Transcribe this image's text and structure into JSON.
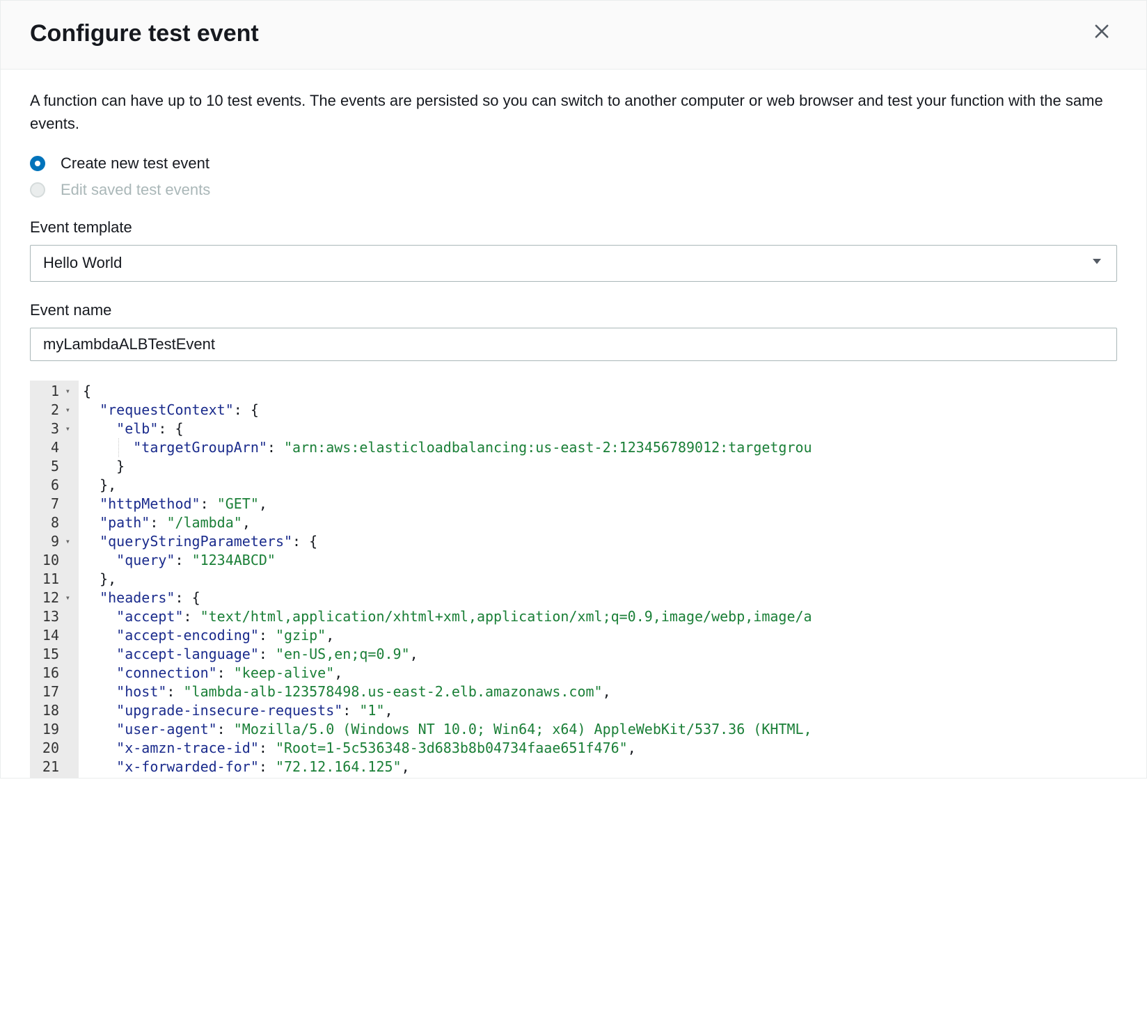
{
  "modal": {
    "title": "Configure test event",
    "description": "A function can have up to 10 test events. The events are persisted so you can switch to another computer or web browser and test your function with the same events."
  },
  "radios": {
    "create_label": "Create new test event",
    "edit_label": "Edit saved test events"
  },
  "template": {
    "label": "Event template",
    "selected": "Hello World"
  },
  "event_name": {
    "label": "Event name",
    "value": "myLambdaALBTestEvent"
  },
  "code": {
    "lines": [
      {
        "n": 1,
        "fold": true,
        "indent": 0,
        "tokens": [
          [
            "brace",
            "{"
          ]
        ]
      },
      {
        "n": 2,
        "fold": true,
        "indent": 1,
        "tokens": [
          [
            "key",
            "\"requestContext\""
          ],
          [
            "punct",
            ": "
          ],
          [
            "brace",
            "{"
          ]
        ]
      },
      {
        "n": 3,
        "fold": true,
        "indent": 2,
        "tokens": [
          [
            "key",
            "\"elb\""
          ],
          [
            "punct",
            ": "
          ],
          [
            "brace",
            "{"
          ]
        ]
      },
      {
        "n": 4,
        "fold": false,
        "indent": 3,
        "tokens": [
          [
            "key",
            "\"targetGroupArn\""
          ],
          [
            "punct",
            ": "
          ],
          [
            "str",
            "\"arn:aws:elasticloadbalancing:us-east-2:123456789012:targetgrou"
          ]
        ]
      },
      {
        "n": 5,
        "fold": false,
        "indent": 2,
        "tokens": [
          [
            "brace",
            "}"
          ]
        ]
      },
      {
        "n": 6,
        "fold": false,
        "indent": 1,
        "tokens": [
          [
            "brace",
            "}"
          ],
          [
            "punct",
            ","
          ]
        ]
      },
      {
        "n": 7,
        "fold": false,
        "indent": 1,
        "tokens": [
          [
            "key",
            "\"httpMethod\""
          ],
          [
            "punct",
            ": "
          ],
          [
            "str",
            "\"GET\""
          ],
          [
            "punct",
            ","
          ]
        ]
      },
      {
        "n": 8,
        "fold": false,
        "indent": 1,
        "tokens": [
          [
            "key",
            "\"path\""
          ],
          [
            "punct",
            ": "
          ],
          [
            "str",
            "\"/lambda\""
          ],
          [
            "punct",
            ","
          ]
        ]
      },
      {
        "n": 9,
        "fold": true,
        "indent": 1,
        "tokens": [
          [
            "key",
            "\"queryStringParameters\""
          ],
          [
            "punct",
            ": "
          ],
          [
            "brace",
            "{"
          ]
        ]
      },
      {
        "n": 10,
        "fold": false,
        "indent": 2,
        "tokens": [
          [
            "key",
            "\"query\""
          ],
          [
            "punct",
            ": "
          ],
          [
            "str",
            "\"1234ABCD\""
          ]
        ]
      },
      {
        "n": 11,
        "fold": false,
        "indent": 1,
        "tokens": [
          [
            "brace",
            "}"
          ],
          [
            "punct",
            ","
          ]
        ]
      },
      {
        "n": 12,
        "fold": true,
        "indent": 1,
        "tokens": [
          [
            "key",
            "\"headers\""
          ],
          [
            "punct",
            ": "
          ],
          [
            "brace",
            "{"
          ]
        ]
      },
      {
        "n": 13,
        "fold": false,
        "indent": 2,
        "tokens": [
          [
            "key",
            "\"accept\""
          ],
          [
            "punct",
            ": "
          ],
          [
            "str",
            "\"text/html,application/xhtml+xml,application/xml;q=0.9,image/webp,image/a"
          ]
        ]
      },
      {
        "n": 14,
        "fold": false,
        "indent": 2,
        "tokens": [
          [
            "key",
            "\"accept-encoding\""
          ],
          [
            "punct",
            ": "
          ],
          [
            "str",
            "\"gzip\""
          ],
          [
            "punct",
            ","
          ]
        ]
      },
      {
        "n": 15,
        "fold": false,
        "indent": 2,
        "tokens": [
          [
            "key",
            "\"accept-language\""
          ],
          [
            "punct",
            ": "
          ],
          [
            "str",
            "\"en-US,en;q=0.9\""
          ],
          [
            "punct",
            ","
          ]
        ]
      },
      {
        "n": 16,
        "fold": false,
        "indent": 2,
        "tokens": [
          [
            "key",
            "\"connection\""
          ],
          [
            "punct",
            ": "
          ],
          [
            "str",
            "\"keep-alive\""
          ],
          [
            "punct",
            ","
          ]
        ]
      },
      {
        "n": 17,
        "fold": false,
        "indent": 2,
        "tokens": [
          [
            "key",
            "\"host\""
          ],
          [
            "punct",
            ": "
          ],
          [
            "str",
            "\"lambda-alb-123578498.us-east-2.elb.amazonaws.com\""
          ],
          [
            "punct",
            ","
          ]
        ]
      },
      {
        "n": 18,
        "fold": false,
        "indent": 2,
        "tokens": [
          [
            "key",
            "\"upgrade-insecure-requests\""
          ],
          [
            "punct",
            ": "
          ],
          [
            "str",
            "\"1\""
          ],
          [
            "punct",
            ","
          ]
        ]
      },
      {
        "n": 19,
        "fold": false,
        "indent": 2,
        "tokens": [
          [
            "key",
            "\"user-agent\""
          ],
          [
            "punct",
            ": "
          ],
          [
            "str",
            "\"Mozilla/5.0 (Windows NT 10.0; Win64; x64) AppleWebKit/537.36 (KHTML,"
          ]
        ]
      },
      {
        "n": 20,
        "fold": false,
        "indent": 2,
        "tokens": [
          [
            "key",
            "\"x-amzn-trace-id\""
          ],
          [
            "punct",
            ": "
          ],
          [
            "str",
            "\"Root=1-5c536348-3d683b8b04734faae651f476\""
          ],
          [
            "punct",
            ","
          ]
        ]
      },
      {
        "n": 21,
        "fold": false,
        "indent": 2,
        "tokens": [
          [
            "key",
            "\"x-forwarded-for\""
          ],
          [
            "punct",
            ": "
          ],
          [
            "str",
            "\"72.12.164.125\""
          ],
          [
            "punct",
            ","
          ]
        ]
      }
    ]
  }
}
